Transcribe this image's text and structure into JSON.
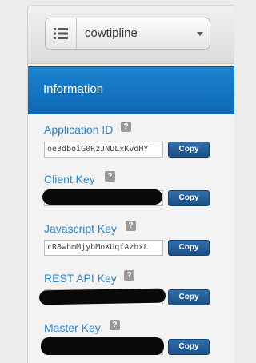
{
  "app_selector": {
    "selected": "cowtipline"
  },
  "section": {
    "title": "Information"
  },
  "fields": [
    {
      "label": "Application ID",
      "value": "oe3dboiG0RzJNULxKvdHY",
      "redacted": false,
      "help": "?",
      "copy_label": "Copy"
    },
    {
      "label": "Client Key",
      "value": "",
      "redacted": true,
      "help": "?",
      "copy_label": "Copy"
    },
    {
      "label": "Javascript Key",
      "value": "cR8whmMjybMoXUqfAzhxL",
      "redacted": false,
      "help": "?",
      "copy_label": "Copy"
    },
    {
      "label": "REST API Key",
      "value": "",
      "redacted": true,
      "help": "?",
      "copy_label": "Copy"
    },
    {
      "label": "Master Key",
      "value": "",
      "redacted": true,
      "help": "?",
      "copy_label": "Copy"
    }
  ],
  "icons": {
    "app_menu": "list-icon",
    "dropdown": "caret-down-icon",
    "help": "question-icon"
  },
  "colors": {
    "header": "#1575c5",
    "label": "#2f86cc",
    "button": "#245f9a"
  }
}
